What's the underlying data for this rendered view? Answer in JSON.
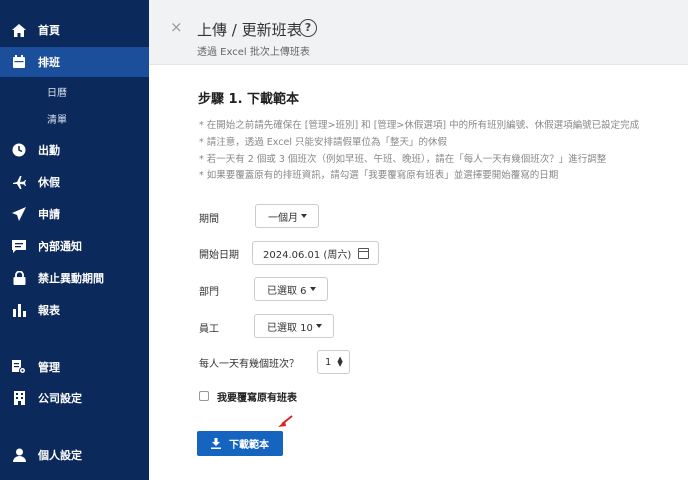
{
  "sidebar": {
    "items": [
      {
        "label": "首頁",
        "icon": "home-icon"
      },
      {
        "label": "排班",
        "icon": "calendar-icon"
      },
      {
        "label": "日曆",
        "icon": ""
      },
      {
        "label": "清單",
        "icon": ""
      },
      {
        "label": "出勤",
        "icon": "clock-icon"
      },
      {
        "label": "休假",
        "icon": "airplane-icon"
      },
      {
        "label": "申請",
        "icon": "send-icon"
      },
      {
        "label": "內部通知",
        "icon": "message-icon"
      },
      {
        "label": "禁止異動期間",
        "icon": "lock-icon"
      },
      {
        "label": "報表",
        "icon": "bar-chart-icon"
      },
      {
        "label": "管理",
        "icon": "settings-doc-icon"
      },
      {
        "label": "公司設定",
        "icon": "building-icon"
      },
      {
        "label": "個人設定",
        "icon": "user-icon"
      }
    ],
    "active": "排班",
    "colors": {
      "background": "#0b2a5b",
      "active": "#1b4f9c"
    }
  },
  "header": {
    "close": "×",
    "title": "上傳 / 更新班表",
    "help": "?",
    "subtitle": "透過 Excel 批次上傳班表"
  },
  "step": {
    "title": "步驟 1. 下載範本",
    "notes": [
      "* 在開始之前請先確保在 [管理>班別] 和 [管理>休假選項] 中的所有班別編號、休假選項編號已設定完成",
      "* 請注意，透過 Excel 只能安排請假單位為「整天」的休假",
      "* 若一天有 2 個或 3 個班次（例如早班、午班、晚班），請在「每人一天有幾個班次？」進行調整",
      "* 如果要覆蓋原有的排班資訊，請勾選「我要覆寫原有班表」並選擇要開始覆寫的日期"
    ]
  },
  "form": {
    "period_label": "期間",
    "period_value": "一個月",
    "start_date_label": "開始日期",
    "start_date_value": "2024.06.01 (周六)",
    "department_label": "部門",
    "department_value": "已選取 6",
    "employee_label": "員工",
    "employee_value": "已選取 10",
    "shifts_label": "每人一天有幾個班次？",
    "shifts_value": "1",
    "overwrite_label": "我要覆寫原有班表",
    "overwrite_checked": false
  },
  "download_button": {
    "label": "下載範本",
    "color": "#1565c0"
  },
  "annotation": {
    "color": "#e02020"
  }
}
